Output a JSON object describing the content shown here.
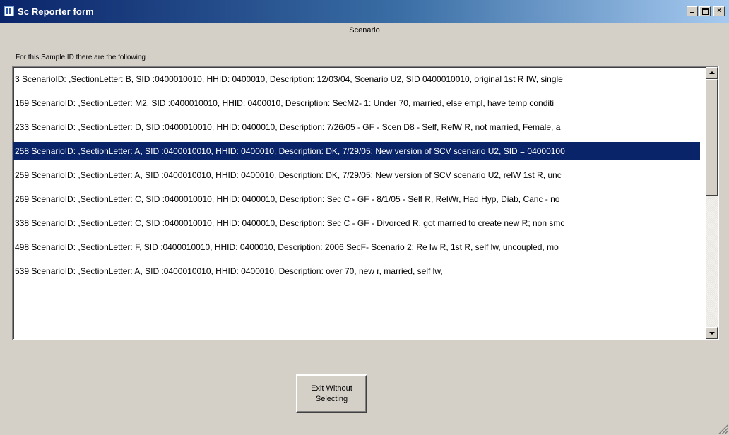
{
  "window": {
    "title": "Sc Reporter form",
    "minimize_label": "",
    "maximize_label": "",
    "close_label": "×"
  },
  "header": {
    "scenario_label": "Scenario",
    "subtitle": "For this Sample ID there are the following"
  },
  "list": {
    "selected_index": 3,
    "items": [
      "3 ScenarioID: ,SectionLetter: B, SID :0400010010, HHID: 0400010, Description: 12/03/04, Scenario U2, SID 0400010010, original 1st R IW, single",
      "169 ScenarioID: ,SectionLetter: M2, SID :0400010010, HHID: 0400010, Description: SecM2- 1:    Under 70, married, else empl, have temp conditi",
      "233 ScenarioID: ,SectionLetter: D, SID :0400010010, HHID: 0400010, Description: 7/26/05 - GF - Scen D8 -  Self, RelW R, not married, Female, a",
      "258 ScenarioID: ,SectionLetter: A, SID :0400010010, HHID: 0400010, Description: DK, 7/29/05: New version of SCV scenario U2, SID = 04000100",
      "259 ScenarioID: ,SectionLetter: A, SID :0400010010, HHID: 0400010, Description: DK, 7/29/05: New version of SCV scenario U2, relW 1st R, unc",
      "269 ScenarioID: ,SectionLetter: C, SID :0400010010, HHID: 0400010, Description: Sec C - GF - 8/1/05 - Self R, RelWr, Had Hyp, Diab, Canc - no",
      "338 ScenarioID: ,SectionLetter: C, SID :0400010010, HHID: 0400010, Description: Sec C - GF - Divorced R, got married to create new R; non smc",
      "498 ScenarioID: ,SectionLetter: F, SID :0400010010, HHID: 0400010, Description: 2006 SecF- Scenario 2:  Re lw R, 1st R, self lw, uncoupled, mo",
      "539 ScenarioID: ,SectionLetter: A, SID :0400010010, HHID: 0400010, Description: over 70, new r, married, self lw,"
    ]
  },
  "buttons": {
    "exit_label": "Exit Without Selecting"
  },
  "colors": {
    "titlebar_start": "#0a246a",
    "titlebar_end": "#a6caf0",
    "selection": "#0a246a",
    "window_bg": "#d4d0c8"
  },
  "icons": {
    "app": "app-icon",
    "minimize": "minimize-icon",
    "maximize": "maximize-icon",
    "close": "close-icon",
    "scroll_up": "arrow-up-icon",
    "scroll_down": "arrow-down-icon",
    "resize": "resize-grip-icon"
  }
}
